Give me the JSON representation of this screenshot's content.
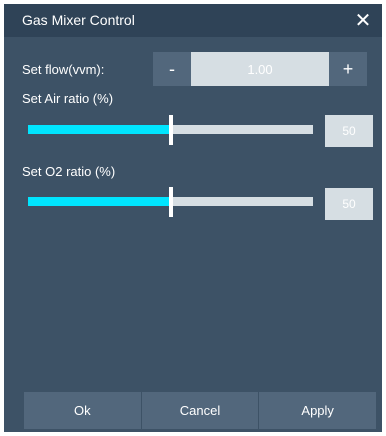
{
  "window": {
    "title": "Gas Mixer Control",
    "close_glyph": "✕"
  },
  "flow": {
    "label": "Set flow(vvm):",
    "value": "1.00",
    "minus_label": "-",
    "plus_label": "+"
  },
  "air": {
    "label": "Set Air ratio (%)",
    "value": "50",
    "level_percent": 50
  },
  "o2": {
    "label": "Set O2 ratio (%)",
    "value": "50",
    "level_percent": 50
  },
  "buttons": {
    "ok": "Ok",
    "cancel": "Cancel",
    "apply": "Apply"
  },
  "colors": {
    "panel": "#3d5266",
    "titlebar": "#2f4357",
    "button": "#52677c",
    "field": "#d6dee3",
    "slider_fill": "#00e5ff"
  }
}
